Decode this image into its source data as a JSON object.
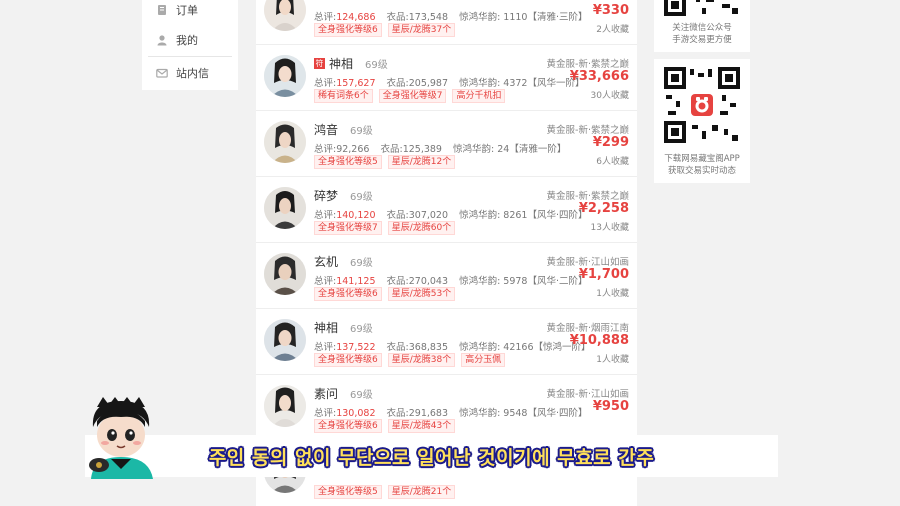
{
  "leftnav": {
    "items": [
      {
        "label": "订单",
        "icon": "order-icon"
      },
      {
        "label": "我的",
        "icon": "user-icon"
      },
      {
        "label": "站内信",
        "icon": "mail-icon"
      }
    ]
  },
  "listings": [
    {
      "name": "",
      "level": "",
      "score_label": "总评:",
      "score": "124,686",
      "outfit_label": "衣品:",
      "outfit": "173,548",
      "rank": "惊鸿华韵: 1110【清雅·三阶】",
      "tags": [
        "全身强化等级6",
        "星辰/龙腾37个"
      ],
      "server": "",
      "price": "¥330",
      "fav": "2人收藏"
    },
    {
      "name": "神相",
      "level": "69级",
      "badge": "符",
      "score_label": "总评:",
      "score": "157,627",
      "outfit_label": "衣品:",
      "outfit": "205,987",
      "rank": "惊鸿华韵: 4372【风华一阶】",
      "tags": [
        "稀有词条6个",
        "全身强化等级7",
        "高分千机扣"
      ],
      "server": "黄金服-新·紫禁之巅",
      "price": "¥33,666",
      "fav": "30人收藏"
    },
    {
      "name": "鸿音",
      "level": "69级",
      "score_label": "总评:",
      "score": "92,266",
      "outfit_label": "衣品:",
      "outfit": "125,389",
      "rank": "惊鸿华韵: 24【清雅一阶】",
      "tags": [
        "全身强化等级5",
        "星辰/龙腾12个"
      ],
      "server": "黄金服-新·紫禁之巅",
      "price": "¥299",
      "fav": "6人收藏"
    },
    {
      "name": "碎梦",
      "level": "69级",
      "score_label": "总评:",
      "score": "140,120",
      "outfit_label": "衣品:",
      "outfit": "307,020",
      "rank": "惊鸿华韵: 8261【风华·四阶】",
      "tags": [
        "全身强化等级7",
        "星辰/龙腾60个"
      ],
      "server": "黄金服-新·紫禁之巅",
      "price": "¥2,258",
      "fav": "13人收藏"
    },
    {
      "name": "玄机",
      "level": "69级",
      "score_label": "总评:",
      "score": "141,125",
      "outfit_label": "衣品:",
      "outfit": "270,043",
      "rank": "惊鸿华韵: 5978【风华·二阶】",
      "tags": [
        "全身强化等级6",
        "星辰/龙腾53个"
      ],
      "server": "黄金服-新·江山如画",
      "price": "¥1,700",
      "fav": "1人收藏"
    },
    {
      "name": "神相",
      "level": "69级",
      "score_label": "总评:",
      "score": "137,522",
      "outfit_label": "衣品:",
      "outfit": "368,835",
      "rank": "惊鸿华韵: 42166【惊鸿一阶】",
      "tags": [
        "全身强化等级6",
        "星辰/龙腾38个",
        "高分玉佩"
      ],
      "server": "黄金服-新·烟雨江南",
      "price": "¥10,888",
      "fav": "1人收藏"
    },
    {
      "name": "素问",
      "level": "69级",
      "score_label": "总评:",
      "score": "130,082",
      "outfit_label": "衣品:",
      "outfit": "291,683",
      "rank": "惊鸿华韵: 9548【风华·四阶】",
      "tags": [
        "全身强化等级6",
        "星辰/龙腾43个"
      ],
      "server": "黄金服-新·江山如画",
      "price": "¥950",
      "fav": ""
    },
    {
      "name": "",
      "level": "",
      "score_label": "",
      "score": "",
      "outfit_label": "",
      "outfit": "",
      "rank": "",
      "tags": [
        "全身强化等级5",
        "星辰/龙腾21个"
      ],
      "server": "",
      "price": "",
      "fav": ""
    }
  ],
  "qr": [
    {
      "caption_line1": "关注微信公众号",
      "caption_line2": "手游交易更方便",
      "icon": "wechat-qr-icon"
    },
    {
      "caption_line1": "下载网易藏宝阁APP",
      "caption_line2": "获取交易实时动态",
      "icon": "app-qr-icon"
    }
  ],
  "subtitle": "주인 동의 없이 무단으로 일어난 것이기에 무효로 간주",
  "colors": {
    "accent": "#e64340",
    "subtitle_fill": "#ffe05a",
    "subtitle_stroke": "#1a1a8a"
  }
}
